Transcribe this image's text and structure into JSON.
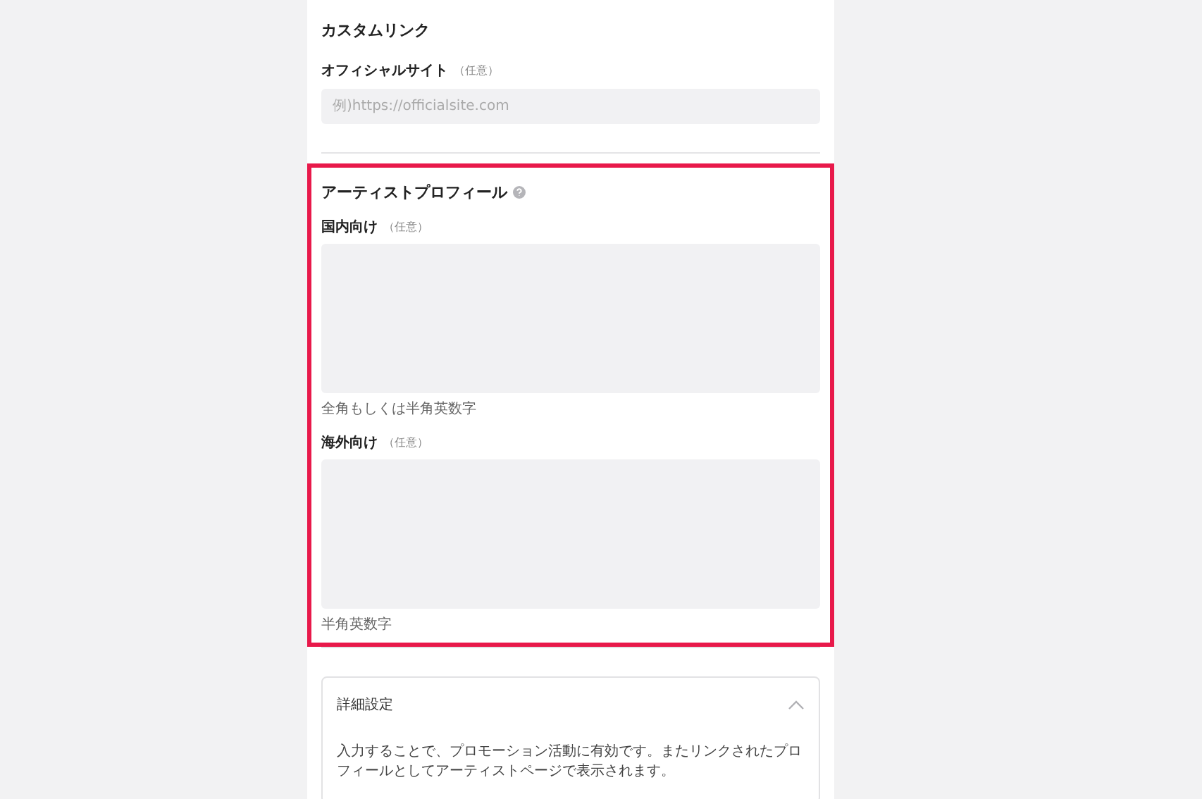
{
  "custom_link": {
    "title": "カスタムリンク",
    "field": {
      "label": "オフィシャルサイト",
      "optional": "（任意）",
      "placeholder": "例)https://officialsite.com"
    }
  },
  "artist_profile": {
    "title": "アーティストプロフィール",
    "highlighted": true,
    "fields": [
      {
        "label": "国内向け",
        "optional": "（任意）",
        "hint": "全角もしくは半角英数字"
      },
      {
        "label": "海外向け",
        "optional": "（任意）",
        "hint": "半角英数字"
      }
    ]
  },
  "details": {
    "title": "詳細設定",
    "expanded": true,
    "description": "入力することで、プロモーション活動に有効です。またリンクされたプロフィールとしてアーティストページで表示されます。"
  }
}
